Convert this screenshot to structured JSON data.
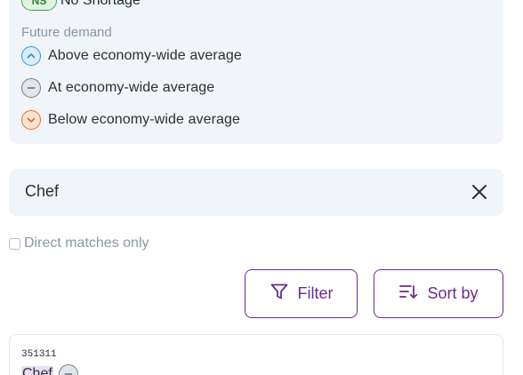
{
  "legend": {
    "shortage_badge": "NS",
    "shortage_label": "No Shortage",
    "future_demand_heading": "Future demand",
    "items": [
      {
        "label": "Above economy-wide average",
        "icon": "chevron-up-icon",
        "color": "#3a93c9"
      },
      {
        "label": "At economy-wide average",
        "icon": "minus-icon",
        "color": "#747c87"
      },
      {
        "label": "Below economy-wide average",
        "icon": "chevron-down-icon",
        "color": "#d9732a"
      }
    ]
  },
  "search": {
    "value": "Chef",
    "clear_icon": "close-icon"
  },
  "filters": {
    "direct_matches_label": "Direct matches only",
    "direct_matches_checked": false
  },
  "toolbar": {
    "filter_label": "Filter",
    "sort_label": "Sort by",
    "accent": "#6a2c8a"
  },
  "results": [
    {
      "code": "351311",
      "title": "Chef",
      "demand": "at"
    }
  ]
}
